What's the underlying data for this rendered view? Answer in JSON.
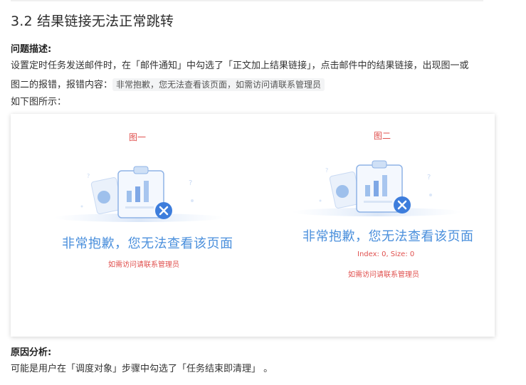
{
  "section": {
    "title": "3.2 结果链接无法正常跳转"
  },
  "problem": {
    "heading": "问题描述:",
    "text_line1": "设置定时任务发送邮件时，在「邮件通知」中勾选了「正文加上结果链接」，点击邮件中的结果链接，出现图一或",
    "text_line2_prefix": "图二的报错，报错内容：",
    "error_code": "非常抱歉，您无法查看该页面，如需访问请联系管理员",
    "figure_intro": "如下图所示："
  },
  "figure": {
    "fig1": {
      "caption": "图一",
      "title": "非常抱歉，您无法查看该页面",
      "subtitle": "如需访问请联系管理员"
    },
    "fig2": {
      "caption": "图二",
      "title": "非常抱歉，您无法查看该页面",
      "detail": "Index: 0, Size: 0",
      "subtitle": "如需访问请联系管理员"
    }
  },
  "cause": {
    "heading": "原因分析:",
    "text": "可能是用户在「调度对象」步骤中勾选了「任务结束即清理」 。"
  },
  "colors": {
    "accent_blue": "#4a8fdc",
    "error_red": "#e0504e"
  }
}
